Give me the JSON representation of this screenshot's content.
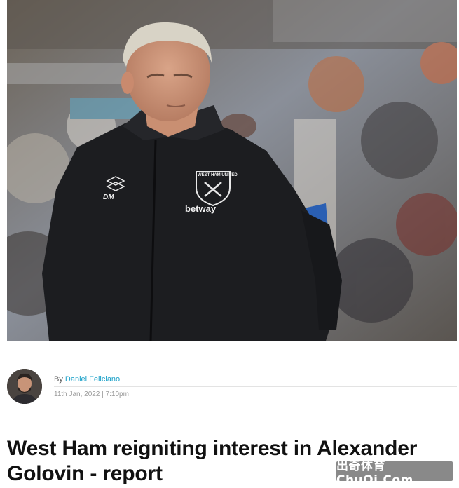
{
  "hero": {
    "crest_text": "WEST HAM UNITED",
    "sponsor_text": "betway",
    "initials_text": "DM"
  },
  "author": {
    "by_prefix": "By",
    "name": "Daniel Feliciano",
    "date": "11th Jan, 2022 | 7:10pm"
  },
  "article": {
    "title": "West Ham reigniting interest in Alexander Golovin - report"
  },
  "watermark": {
    "text": "出奇体育ChuQi.Com"
  },
  "colors": {
    "link": "#1aa0c8",
    "jacket": "#1c1d20"
  }
}
